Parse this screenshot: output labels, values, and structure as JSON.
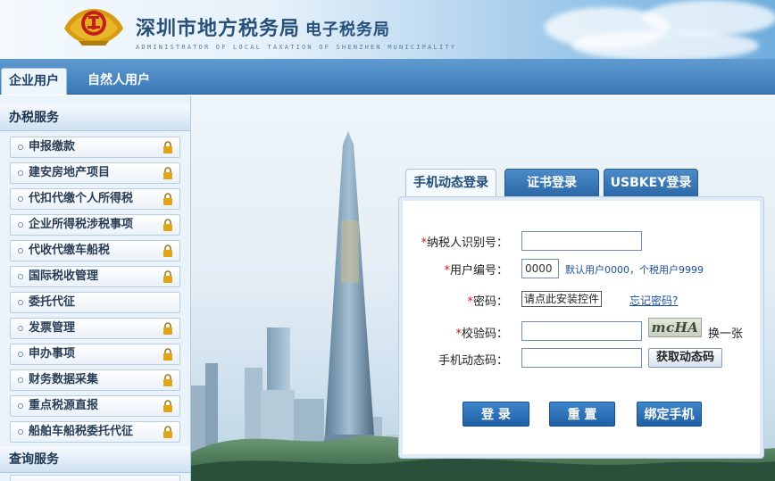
{
  "header": {
    "title": "深圳市地方税务局",
    "subtitle_label": "电子税务局",
    "english_line": "ADMINISTRATOR OF LOCAL TAXATION OF SHENZHEN MUNICIPALITY"
  },
  "user_tabs": [
    {
      "label": "企业用户",
      "active": true
    },
    {
      "label": "自然人用户",
      "active": false
    }
  ],
  "sidebar": {
    "section_tax_services": "办税服务",
    "items": [
      {
        "label": "申报缴款",
        "locked": true
      },
      {
        "label": "建安房地产项目",
        "locked": true
      },
      {
        "label": "代扣代缴个人所得税",
        "locked": true
      },
      {
        "label": "企业所得税涉税事项",
        "locked": true
      },
      {
        "label": "代收代缴车船税",
        "locked": true
      },
      {
        "label": "国际税收管理",
        "locked": true
      },
      {
        "label": "委托代征",
        "locked": false
      },
      {
        "label": "发票管理",
        "locked": true
      },
      {
        "label": "申办事项",
        "locked": true
      },
      {
        "label": "财务数据采集",
        "locked": true
      },
      {
        "label": "重点税源直报",
        "locked": true
      },
      {
        "label": "船舶车船税委托代征",
        "locked": true
      }
    ],
    "section_query_services": "查询服务"
  },
  "login": {
    "tabs": [
      {
        "label": "手机动态登录",
        "active": true
      },
      {
        "label": "证书登录",
        "active": false
      },
      {
        "label": "USBKEY登录",
        "active": false
      }
    ],
    "taxpayer_id_label": "纳税人识别号：",
    "taxpayer_id_value": "",
    "user_no_label": "用户编号：",
    "user_no_value": "0000",
    "user_no_hint": "默认用户0000，个税用户9999",
    "password_label": "密码：",
    "password_placeholder": "请点此安装控件",
    "forgot_password": "忘记密码?",
    "captcha_label": "校验码：",
    "captcha_value": "",
    "captcha_image_text": "mcHA",
    "captcha_refresh": "换一张",
    "sms_code_label": "手机动态码：",
    "sms_code_value": "",
    "get_code_button": "获取动态码",
    "login_button": "登 录",
    "reset_button": "重 置",
    "bind_phone_button": "绑定手机",
    "required_mark": "*"
  },
  "colors": {
    "accent_blue": "#2d68a6",
    "required_red": "#d11616",
    "link_blue": "#1a4f9a",
    "lock_gold": "#e0a516"
  },
  "icons": [
    "emblem-icon",
    "lock-icon",
    "bullet-icon"
  ]
}
